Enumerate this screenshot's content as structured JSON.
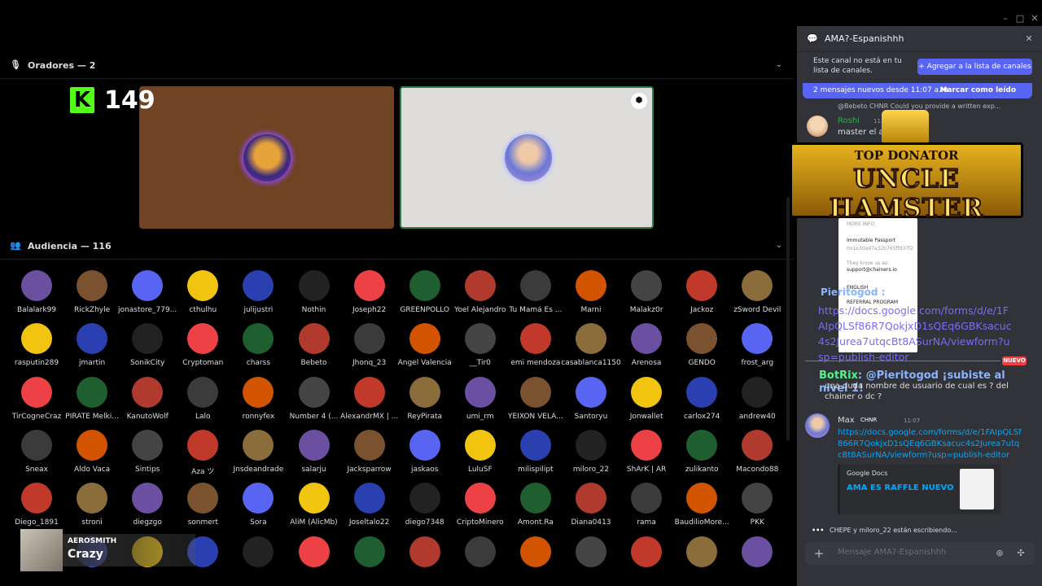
{
  "stage": {
    "speakers_header": "Oradores — 2",
    "audience_header": "Audiencia — 116",
    "kick_logo": "K",
    "kick_count": "149"
  },
  "audience": [
    "Balalark99",
    "RickZhyle",
    "jonastore_779...",
    "cthulhu",
    "julijustri",
    "Nothin",
    "Joseph22",
    "GREENPOLLO",
    "Yoel Alejandro",
    "Tu Mamá Es ...",
    "Marni",
    "Malakz0r",
    "Jackoz",
    "zSword Devil",
    "rasputin289",
    "jmartin",
    "SonikCity",
    "Cryptoman",
    "charss",
    "Bebeto",
    "Jhonq_23",
    "Ángel Valencia",
    "__Tir0",
    "emi mendoza",
    "casablanca1150",
    "Arenosa",
    "GENDO",
    "frost_arg",
    "TirCogneCraz",
    "PIRATE Melki...",
    "KanutoWolf",
    "Lalo",
    "ronnyfex",
    "Number 4 (...",
    "AlexandrMX | ...",
    "ReyPirata",
    "umi_rm",
    "YEIXON VELA...",
    "Santoryu",
    "Jonwallet",
    "carlox274",
    "andrew40",
    "Sneax",
    "Aldo Vaca",
    "Sintips",
    "Aza ツ",
    "Jnsdeandrade",
    "salarju",
    "Jacksparrow",
    "jaskaos",
    "LuluSF",
    "milispilipt",
    "miloro_22",
    "ShArK | AR",
    "zulikanto",
    "Macondo88",
    "Diego_1891",
    "stroni",
    "diegzgo",
    "sonmert",
    "Sora",
    "AliM (AlicMb)",
    "Joseltalo22",
    "diego7348",
    "CriptoMinero",
    "Amont.Ra",
    "Diana0413",
    "rama",
    "BaudilioMore...",
    "PKK",
    "",
    "",
    "",
    "",
    "",
    "",
    "",
    "",
    "",
    "",
    "",
    "",
    "",
    ""
  ],
  "overlay": {
    "artist": "AEROSMITH",
    "song": "Crazy"
  },
  "sidebar": {
    "title": "AMA?-Espanishhh",
    "notice": "Este canal no está en tu lista de canales.",
    "add_button": "+ Agregar a la lista de canales",
    "new_messages": "2 mensajes nuevos desde 11:07 a.m.",
    "mark_read": "Marcar como leído",
    "reply_preview": "@Bebeto  CHNR  Could you provide a written exp...",
    "roshi_name": "Roshi",
    "roshi_time": "11:0",
    "roshi_body": "master el ar                    ñol",
    "popup": {
      "l1": "MORE INFO",
      "l2": "Immutable Passport",
      "l3": "0x1e30a97a32b765ffd37f2",
      "l4": "They know us as:",
      "l5": "support@chainers.io",
      "l6": "ENGLISH",
      "l7": "REFERRAL PROGRAM"
    },
    "donator_top": "TOP DONATOR",
    "donator_name": "UNCLE HAMSTER",
    "pieri_mention": "Pieritogod :",
    "pieri_url": "https://docs.google.com/forms/d/e/1FAIpQLSf86R7QokjxD1sQEq6GBKsacuc4s2Jurea7utqcBt8ASurNA/viewform?usp=publish-editor",
    "nuevo": "NUEVO",
    "botrix_name": "BotRix",
    "botrix_text": ": @Pieritogod ¡subiste al nivel 1!",
    "chainer_q": "una duda nombre de usuario de cual es ? del chainer o dc ?",
    "max_name": "Max",
    "max_tag": "CHNR",
    "max_time": "11:07",
    "max_url": "https://docs.google.com/forms/d/e/1FAIpQLSf866R7QokjxD1sQEq6GBKsacuc4s2Jurea7utqcBt8ASurNA/viewform?usp=publish-editor",
    "embed_source": "Google Docs",
    "embed_title": "AMA ES RAFFLE NUEVO",
    "typing": "CHEPE y miloro_22 están escribiendo...",
    "input_placeholder": "Mensaje AMA?-Espanishhh"
  },
  "colors": {
    "accent": "#5865f2",
    "new_badge": "#f23f43",
    "kick_green": "#53fc18",
    "link": "#00a8fc"
  }
}
